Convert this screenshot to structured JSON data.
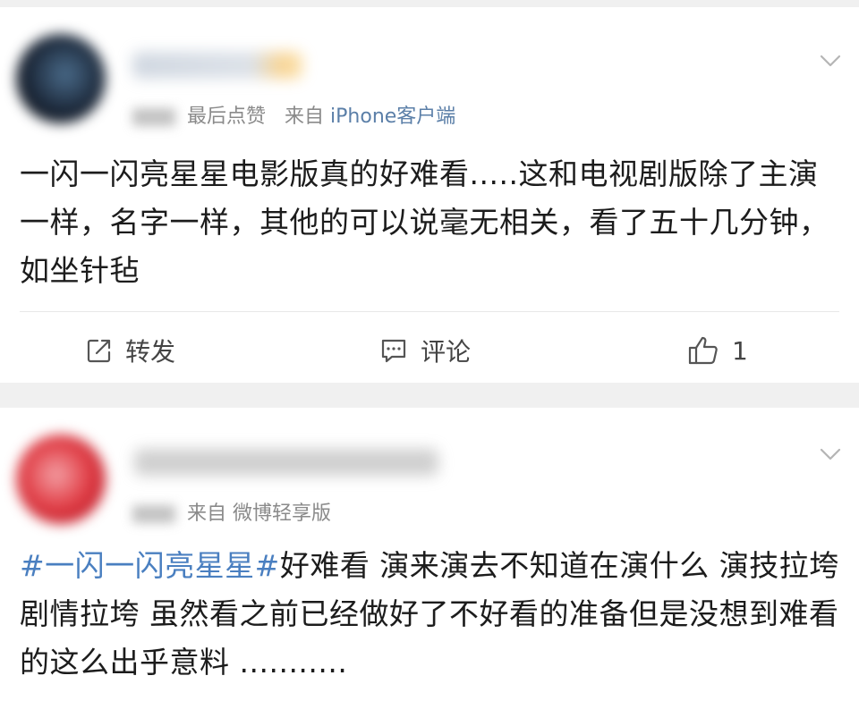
{
  "posts": [
    {
      "time_source_label": "最后点赞",
      "source_prefix": "来自",
      "source_name": "iPhone客户端",
      "body": "一闪一闪亮星星电影版真的好难看.....这和电视剧版除了主演一样，名字一样，其他的可以说毫无相关，看了五十几分钟，如坐针毡",
      "actions": {
        "repost": "转发",
        "comment": "评论",
        "like_count": "1"
      }
    },
    {
      "source_prefix": "来自",
      "source_name": "微博轻享版",
      "topic": "#一闪一闪亮星星#",
      "body": "好难看 演来演去不知道在演什么 演技拉垮 剧情拉垮 虽然看之前已经做好了不好看的准备但是没想到难看的这么出乎意料 ..........."
    }
  ],
  "icons": [
    "chevron-down-icon",
    "repost-icon",
    "comment-icon",
    "like-icon"
  ],
  "colors": {
    "background": "#f0f0f0",
    "card": "#ffffff",
    "text": "#1c1c1c",
    "meta": "#8a8a8a",
    "source_link": "#5b7fa8",
    "topic": "#4a7fc0"
  }
}
